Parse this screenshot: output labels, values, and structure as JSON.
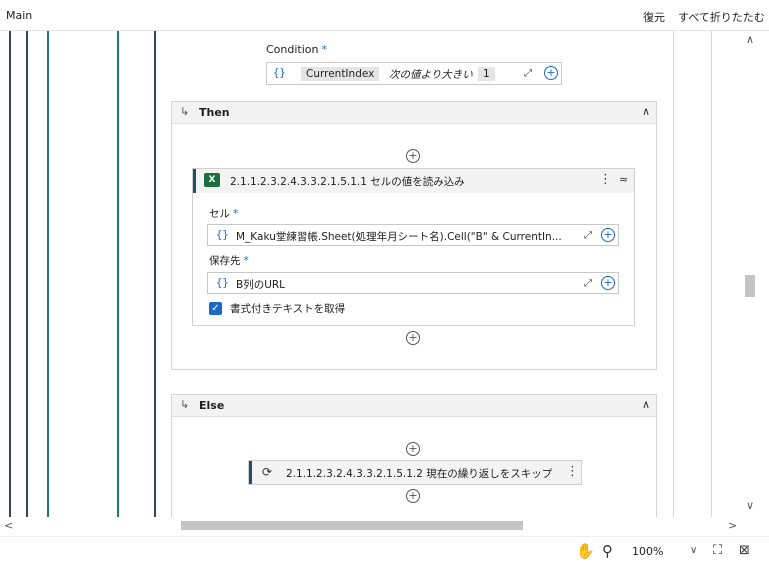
{
  "header": {
    "title": "Main",
    "restore_label": "復元",
    "collapse_all_label": "すべて折りたたむ"
  },
  "condition": {
    "label": "Condition",
    "required_mark": "*",
    "brace": "{}",
    "variable": "CurrentIndex",
    "operator": "次の値より大きい",
    "value": "1"
  },
  "then_section": {
    "label": "Then",
    "action": {
      "title": "2.1.1.2.3.2.4.3.3.2.1.5.1.1 セルの値を読み込み",
      "cell_label": "セル",
      "cell_value": "M_Kaku堂練習帳.Sheet(処理年月シート名).Cell(\"B\" & CurrentIn...",
      "save_label": "保存先",
      "save_value": "B列のURL",
      "checkbox_label": "書式付きテキストを取得",
      "required_mark": "*",
      "brace": "{}"
    }
  },
  "else_section": {
    "label": "Else",
    "action": {
      "title": "2.1.1.2.3.2.4.3.3.2.1.5.1.2 現在の繰り返しをスキップ"
    }
  },
  "status": {
    "zoom": "100%"
  },
  "icons": {
    "hand": "hand-pan-icon",
    "search": "zoom-search-icon",
    "fit": "fit-to-screen-icon",
    "expand": "expand-view-icon"
  },
  "colors": {
    "accent_blue": "#1a6ac8",
    "teal_line": "#1a7f6e",
    "dark_line": "#3a4350",
    "excel_green": "#1d6f42"
  }
}
